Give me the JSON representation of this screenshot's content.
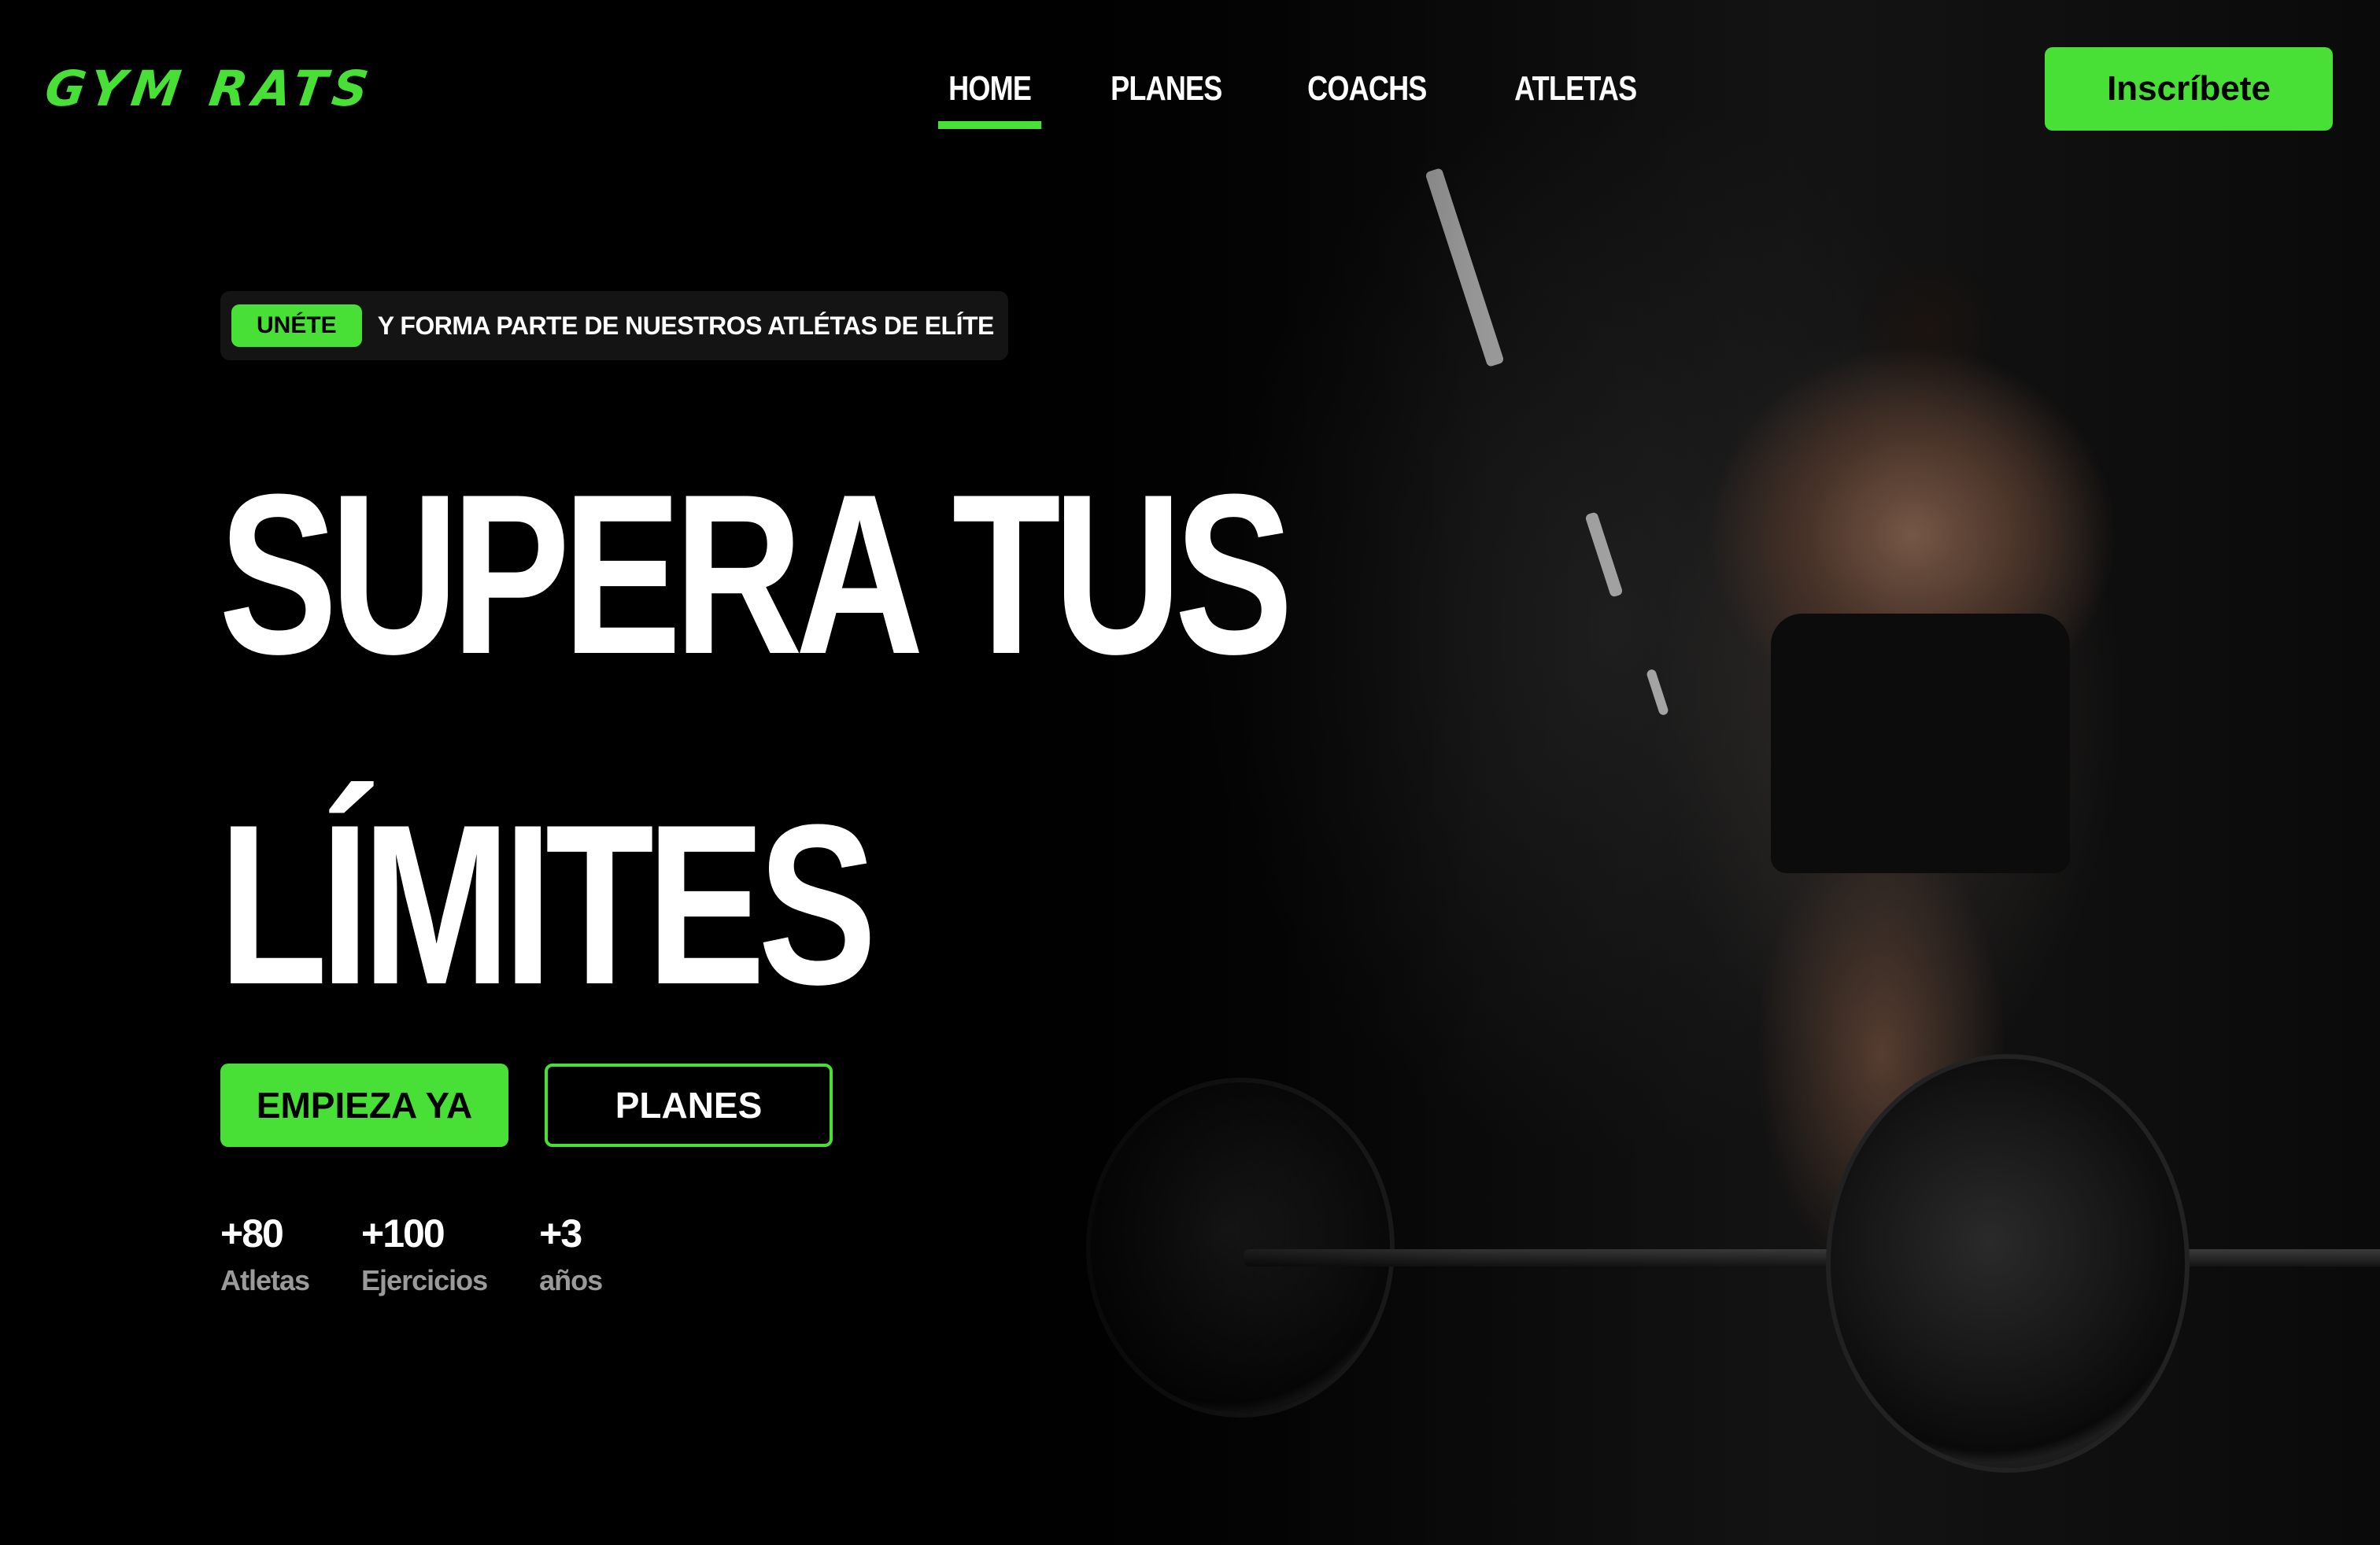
{
  "brand": {
    "logo_text": "GYM RATS",
    "accent_color": "#48e036"
  },
  "nav": {
    "items": [
      {
        "label": "HOME",
        "active": true
      },
      {
        "label": "PLANES",
        "active": false
      },
      {
        "label": "COACHS",
        "active": false
      },
      {
        "label": "ATLETAS",
        "active": false
      }
    ],
    "cta_label": "Inscríbete"
  },
  "hero": {
    "badge": "UNÉTE",
    "tagline": "Y FORMA PARTE DE NUESTROS ATLÉTAS DE ELÍTE",
    "headline_line1": "SUPERA TUS",
    "headline_line2": "LÍMITES",
    "primary_button": "EMPIEZA YA",
    "secondary_button": "PLANES",
    "image_subject": "athlete-with-barbell"
  },
  "stats": [
    {
      "value": "+80",
      "label": "Atletas"
    },
    {
      "value": "+100",
      "label": "Ejercicios"
    },
    {
      "value": "+3",
      "label": "años"
    }
  ]
}
